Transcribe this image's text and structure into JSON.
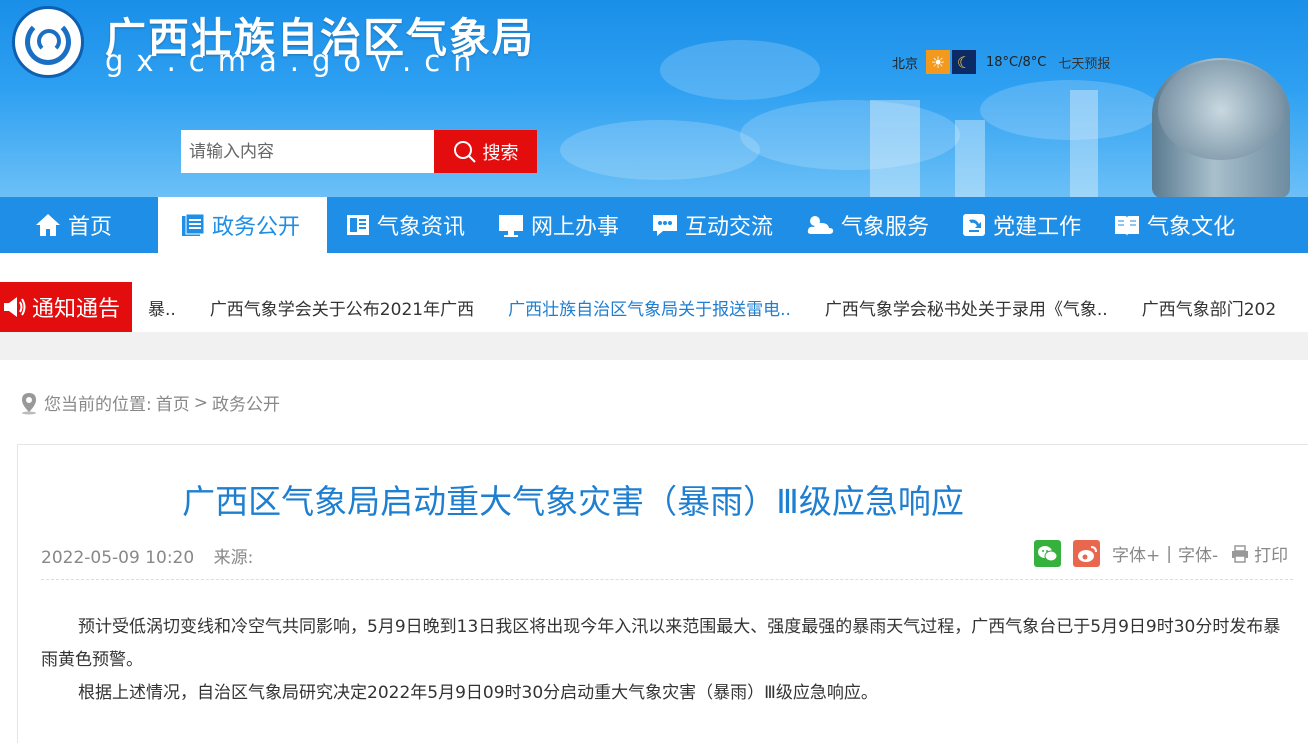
{
  "header": {
    "site_title": "广西壮族自治区气象局",
    "site_domain": "gx.cma.gov.cn"
  },
  "weather": {
    "city": "北京",
    "temperature": "18°C/8°C",
    "forecast_link": "七天预报",
    "day_icon": "sun-icon",
    "night_icon": "moon-icon"
  },
  "search": {
    "placeholder": "请输入内容",
    "value": "",
    "button_label": "搜索"
  },
  "nav": {
    "items": [
      {
        "label": "首页",
        "icon": "home-icon"
      },
      {
        "label": "政务公开",
        "icon": "document-icon",
        "active": true
      },
      {
        "label": "气象资讯",
        "icon": "news-icon"
      },
      {
        "label": "网上办事",
        "icon": "computer-icon"
      },
      {
        "label": "互动交流",
        "icon": "chat-icon"
      },
      {
        "label": "气象服务",
        "icon": "weather-icon"
      },
      {
        "label": "党建工作",
        "icon": "party-icon"
      },
      {
        "label": "气象文化",
        "icon": "book-icon"
      }
    ]
  },
  "notice": {
    "tag": "通知通告",
    "items": [
      {
        "text": "暴.."
      },
      {
        "text": "广西气象学会关于公布2021年广西"
      },
      {
        "text": "广西壮族自治区气象局关于报送雷电..",
        "highlight": true
      },
      {
        "text": "广西气象学会秘书处关于录用《气象.."
      },
      {
        "text": "广西气象部门202"
      }
    ]
  },
  "breadcrumb": {
    "prefix": "您当前的位置:",
    "home": "首页",
    "separator": ">",
    "current": "政务公开"
  },
  "article": {
    "title": "广西区气象局启动重大气象灾害（暴雨）Ⅲ级应急响应",
    "date": "2022-05-09 10:20",
    "source_label": "来源:",
    "font_increase": "字体+",
    "separator": "|",
    "font_decrease": "字体-",
    "print": "打印",
    "paragraphs": [
      "预计受低涡切变线和冷空气共同影响，5月9日晚到13日我区将出现今年入汛以来范围最大、强度最强的暴雨天气过程，广西气象台已于5月9日9时30分时发布暴雨黄色预警。",
      "根据上述情况，自治区气象局研究决定2022年5月9日09时30分启动重大气象灾害（暴雨）Ⅲ级应急响应。"
    ]
  },
  "colors": {
    "brand_blue": "#1e8ee6",
    "accent_red": "#e30d0d",
    "title_blue": "#1e7ed0"
  }
}
